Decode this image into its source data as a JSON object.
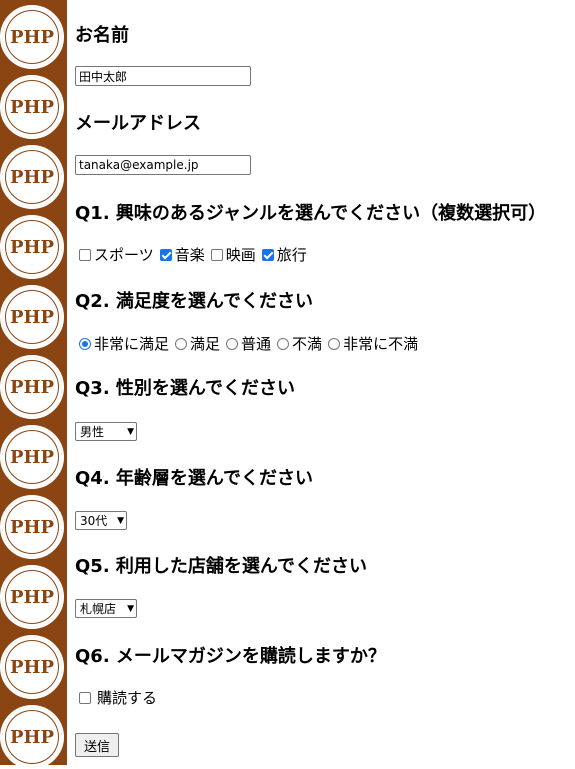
{
  "sidebar": {
    "logo_text": "PHP",
    "logo_color": "#8b4513"
  },
  "form": {
    "name": {
      "label": "お名前",
      "value": "田中太郎"
    },
    "email": {
      "label": "メールアドレス",
      "value": "tanaka@example.jp"
    },
    "q1": {
      "label": "Q1. 興味のあるジャンルを選んでください（複数選択可）",
      "options": [
        {
          "label": "スポーツ",
          "checked": false
        },
        {
          "label": "音楽",
          "checked": true
        },
        {
          "label": "映画",
          "checked": false
        },
        {
          "label": "旅行",
          "checked": true
        }
      ]
    },
    "q2": {
      "label": "Q2. 満足度を選んでください",
      "options": [
        {
          "label": "非常に満足",
          "selected": true
        },
        {
          "label": "満足",
          "selected": false
        },
        {
          "label": "普通",
          "selected": false
        },
        {
          "label": "不満",
          "selected": false
        },
        {
          "label": "非常に不満",
          "selected": false
        }
      ]
    },
    "q3": {
      "label": "Q3. 性別を選んでください",
      "selected": "男性"
    },
    "q4": {
      "label": "Q4. 年齢層を選んでください",
      "selected": "30代"
    },
    "q5": {
      "label": "Q5. 利用した店舗を選んでください",
      "selected": "札幌店"
    },
    "q6": {
      "label": "Q6. メールマガジンを購読しますか？",
      "option_label": "購読する",
      "checked": false
    },
    "submit_label": "送信"
  },
  "colors": {
    "accent": "#1a73e8",
    "sidebar_bg": "#8b4513"
  }
}
